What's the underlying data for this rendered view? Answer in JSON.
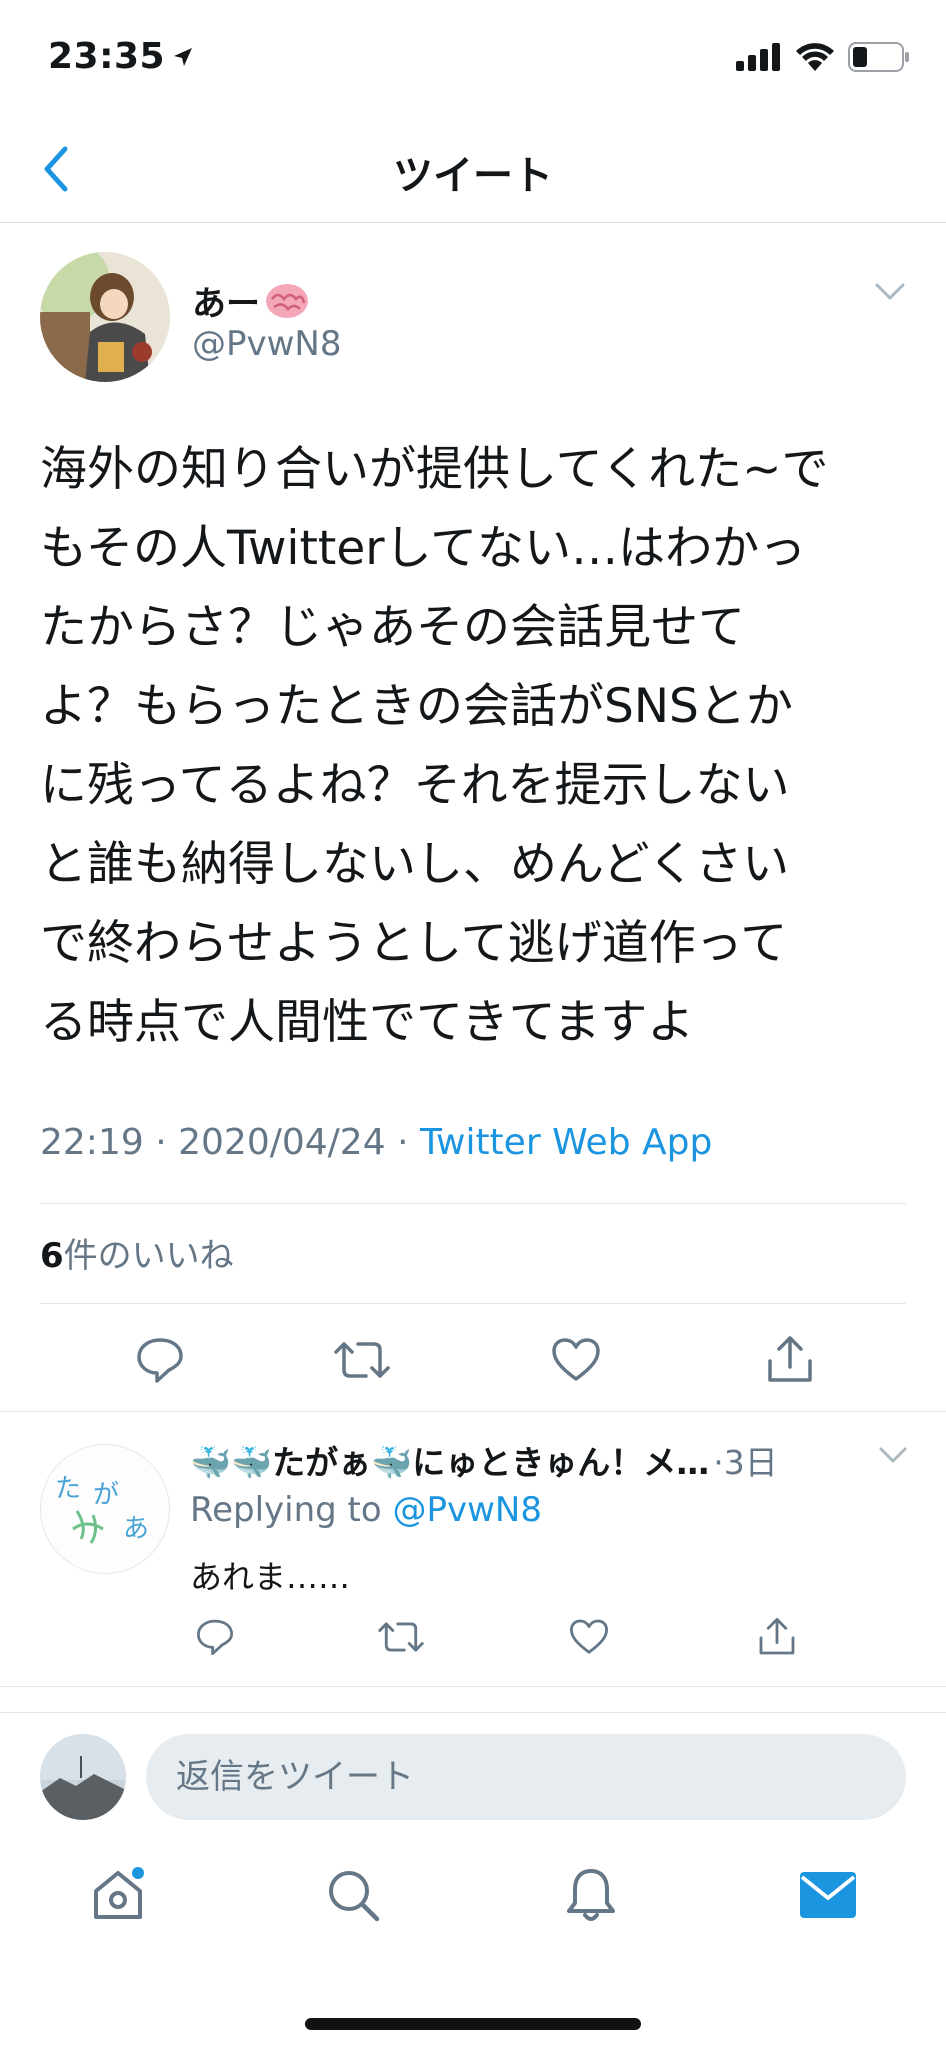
{
  "status_bar": {
    "time": "23:35"
  },
  "nav": {
    "title": "ツイート"
  },
  "tweet": {
    "name": "あー",
    "handle": "@PvwN8",
    "text": "海外の知り合いが提供してくれた~で\nもその人Twitterしてない…はわかっ\nたからさ？じゃあその会話見せて\nよ？もらったときの会話がSNSとか\nに残ってるよね？それを提示しない\nと誰も納得しないし、めんどくさい\nで終わらせようとして逃げ道作って\nる時点で人間性でてきてますよ",
    "time": "22:19",
    "date": "2020/04/24",
    "separator": "·",
    "app": "Twitter Web App",
    "likes_count": "6",
    "likes_label": "件のいいね"
  },
  "reply": {
    "name": "🐳🐳たがぁ🐳にゅときゅん！メ…",
    "time": "·3日",
    "replying_prefix": "Replying to",
    "replying_handle": "@PvwN8",
    "text": "あれま……",
    "avatar_text": "たがぁ"
  },
  "compose": {
    "placeholder": "返信をツイート"
  },
  "colors": {
    "accent": "#1b95e0",
    "text": "#14171a",
    "secondary": "#657786",
    "divider": "#e1e8ed"
  },
  "icons": [
    "back-chevron-icon",
    "brain-emoji-icon",
    "reply-icon",
    "retweet-icon",
    "like-icon",
    "share-icon",
    "home-icon",
    "search-icon",
    "notifications-icon",
    "messages-icon"
  ]
}
